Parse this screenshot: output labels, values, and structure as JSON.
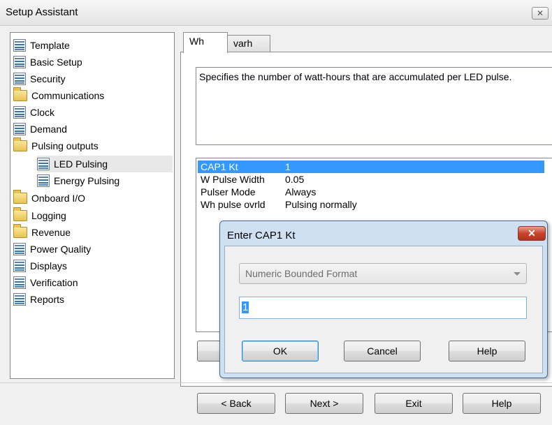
{
  "window": {
    "title": "Setup Assistant",
    "close_glyph": "✕"
  },
  "tree": {
    "items": [
      {
        "label": "Template",
        "icon": "doc"
      },
      {
        "label": "Basic Setup",
        "icon": "doc"
      },
      {
        "label": "Security",
        "icon": "doc"
      },
      {
        "label": "Communications",
        "icon": "folder"
      },
      {
        "label": "Clock",
        "icon": "doc"
      },
      {
        "label": "Demand",
        "icon": "doc"
      },
      {
        "label": "Pulsing outputs",
        "icon": "folder"
      },
      {
        "label": "LED Pulsing",
        "icon": "doc",
        "selected": true
      },
      {
        "label": "Energy Pulsing",
        "icon": "doc"
      },
      {
        "label": "Onboard I/O",
        "icon": "folder"
      },
      {
        "label": "Logging",
        "icon": "folder"
      },
      {
        "label": "Revenue",
        "icon": "folder"
      },
      {
        "label": "Power Quality",
        "icon": "doc"
      },
      {
        "label": "Displays",
        "icon": "doc"
      },
      {
        "label": "Verification",
        "icon": "doc"
      },
      {
        "label": "Reports",
        "icon": "doc"
      }
    ]
  },
  "tabs": [
    {
      "label": "Wh",
      "active": true
    },
    {
      "label": "varh",
      "active": false
    }
  ],
  "description": "Specifies the number of watt-hours that are accumulated per LED pulse.",
  "properties": [
    {
      "name": "CAP1 Kt",
      "value": "1",
      "selected": true
    },
    {
      "name": "W Pulse Width",
      "value": "0.05"
    },
    {
      "name": "Pulser Mode",
      "value": "Always"
    },
    {
      "name": "Wh pulse ovrld",
      "value": "Pulsing normally"
    }
  ],
  "dialog": {
    "title": "Enter CAP1 Kt",
    "close_glyph": "✕",
    "format": "Numeric Bounded Format",
    "value": "1",
    "ok": "OK",
    "cancel": "Cancel",
    "help": "Help"
  },
  "footer": {
    "back": "< Back",
    "next": "Next >",
    "exit": "Exit",
    "help": "Help"
  },
  "colors": {
    "selection": "#3399ff",
    "dialog_frame": "#cfe0f2",
    "close_red": "#c7432a"
  }
}
